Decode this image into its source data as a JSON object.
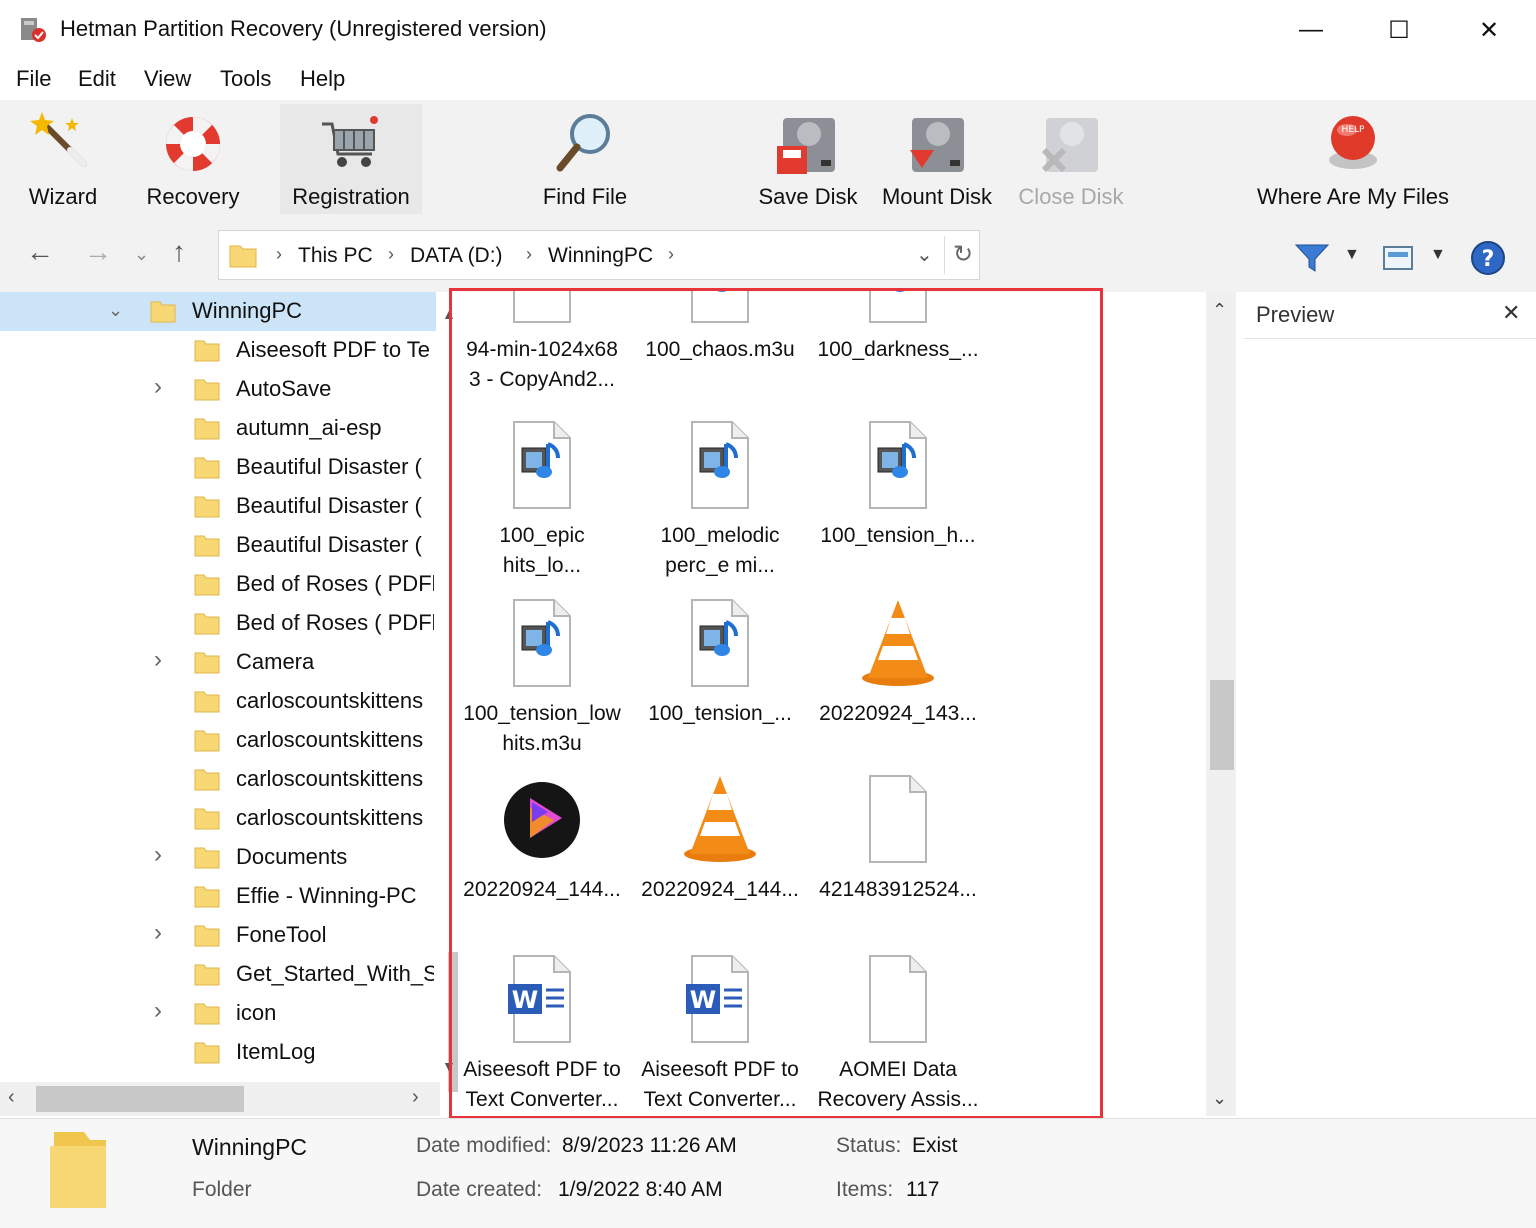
{
  "window": {
    "title": "Hetman Partition Recovery (Unregistered version)",
    "minimize": "—",
    "maximize": "☐",
    "close": "✕"
  },
  "menu": [
    "File",
    "Edit",
    "View",
    "Tools",
    "Help"
  ],
  "toolbar": {
    "wizard": "Wizard",
    "recovery": "Recovery",
    "registration": "Registration",
    "find_file": "Find File",
    "save_disk": "Save Disk",
    "mount_disk": "Mount Disk",
    "close_disk": "Close Disk",
    "where_are_my_files": "Where Are My Files",
    "help_badge": "HELP"
  },
  "breadcrumb": [
    "This PC",
    "DATA (D:)",
    "WinningPC"
  ],
  "tree": {
    "root": "WinningPC",
    "items": [
      {
        "label": "Aiseesoft PDF to Te",
        "expandable": false
      },
      {
        "label": "AutoSave",
        "expandable": true
      },
      {
        "label": "autumn_ai-esp",
        "expandable": false
      },
      {
        "label": "Beautiful Disaster (",
        "expandable": false
      },
      {
        "label": "Beautiful Disaster (",
        "expandable": false
      },
      {
        "label": "Beautiful Disaster (",
        "expandable": false
      },
      {
        "label": "Bed of Roses ( PDFl",
        "expandable": false
      },
      {
        "label": "Bed of Roses ( PDFl",
        "expandable": false
      },
      {
        "label": "Camera",
        "expandable": true
      },
      {
        "label": "carloscountskittens",
        "expandable": false
      },
      {
        "label": "carloscountskittens",
        "expandable": false
      },
      {
        "label": "carloscountskittens",
        "expandable": false
      },
      {
        "label": "carloscountskittens",
        "expandable": false
      },
      {
        "label": "Documents",
        "expandable": true
      },
      {
        "label": "Effie - Winning-PC",
        "expandable": false
      },
      {
        "label": "FoneTool",
        "expandable": true
      },
      {
        "label": "Get_Started_With_S",
        "expandable": false
      },
      {
        "label": "icon",
        "expandable": true
      },
      {
        "label": "ItemLog",
        "expandable": false
      }
    ]
  },
  "files": [
    {
      "line1": "94-min-1024x68",
      "line2": "3 - CopyAnd2...",
      "icon": "image-file-icon"
    },
    {
      "line1": "100_chaos.m3u",
      "line2": "",
      "icon": "media-playlist-icon"
    },
    {
      "line1": "100_darkness_...",
      "line2": "",
      "icon": "media-playlist-icon"
    },
    {
      "line1": "100_epic",
      "line2": "hits_lo...",
      "icon": "media-playlist-icon"
    },
    {
      "line1": "100_melodic",
      "line2": "perc_e mi...",
      "icon": "media-playlist-icon"
    },
    {
      "line1": "100_tension_h...",
      "line2": "",
      "icon": "media-playlist-icon"
    },
    {
      "line1": "100_tension_low",
      "line2": "hits.m3u",
      "icon": "media-playlist-icon"
    },
    {
      "line1": "100_tension_...",
      "line2": "",
      "icon": "media-playlist-icon"
    },
    {
      "line1": "20220924_143...",
      "line2": "",
      "icon": "vlc-cone-icon"
    },
    {
      "line1": "20220924_144...",
      "line2": "",
      "icon": "video-player-icon"
    },
    {
      "line1": "20220924_144...",
      "line2": "",
      "icon": "vlc-cone-icon"
    },
    {
      "line1": "421483912524...",
      "line2": "",
      "icon": "blank-file-icon"
    },
    {
      "line1": "Aiseesoft PDF to",
      "line2": "Text Converter...",
      "icon": "word-document-icon"
    },
    {
      "line1": "Aiseesoft PDF to",
      "line2": "Text Converter...",
      "icon": "word-document-icon"
    },
    {
      "line1": "AOMEI Data",
      "line2": "Recovery Assis...",
      "icon": "blank-file-icon"
    }
  ],
  "preview": {
    "title": "Preview",
    "close": "✕"
  },
  "status": {
    "name": "WinningPC",
    "type": "Folder",
    "date_modified_label": "Date modified:",
    "date_modified": "8/9/2023 11:26 AM",
    "date_created_label": "Date created:",
    "date_created": "1/9/2022 8:40 AM",
    "status_label": "Status:",
    "status_value": "Exist",
    "items_label": "Items:",
    "items_value": "117"
  },
  "colors": {
    "highlight_outline": "#e8323c",
    "tree_selection": "#cce4f7",
    "folder_yellow": "#f8d775",
    "toolbar_bg": "#f2f2f2"
  }
}
